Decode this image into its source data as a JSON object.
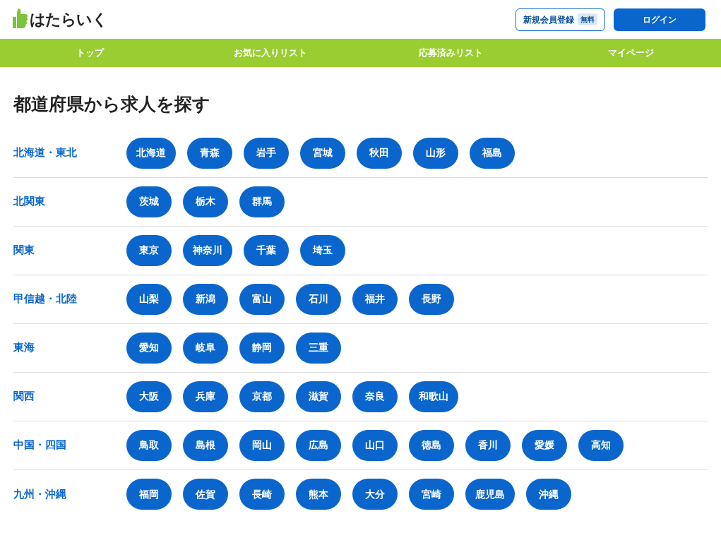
{
  "logo": {
    "text": "はたらいく"
  },
  "header": {
    "register": {
      "label": "新規会員登録",
      "badge": "無料"
    },
    "login": "ログイン"
  },
  "nav": [
    "トップ",
    "お気に入りリスト",
    "応募済みリスト",
    "マイページ"
  ],
  "title": "都道府県から求人を探す",
  "regions": [
    {
      "name": "北海道・東北",
      "prefectures": [
        "北海道",
        "青森",
        "岩手",
        "宮城",
        "秋田",
        "山形",
        "福島"
      ]
    },
    {
      "name": "北関東",
      "prefectures": [
        "茨城",
        "栃木",
        "群馬"
      ]
    },
    {
      "name": "関東",
      "prefectures": [
        "東京",
        "神奈川",
        "千葉",
        "埼玉"
      ]
    },
    {
      "name": "甲信越・北陸",
      "prefectures": [
        "山梨",
        "新潟",
        "富山",
        "石川",
        "福井",
        "長野"
      ]
    },
    {
      "name": "東海",
      "prefectures": [
        "愛知",
        "岐阜",
        "静岡",
        "三重"
      ]
    },
    {
      "name": "関西",
      "prefectures": [
        "大阪",
        "兵庫",
        "京都",
        "滋賀",
        "奈良",
        "和歌山"
      ]
    },
    {
      "name": "中国・四国",
      "prefectures": [
        "鳥取",
        "島根",
        "岡山",
        "広島",
        "山口",
        "徳島",
        "香川",
        "愛媛",
        "高知"
      ]
    },
    {
      "name": "九州・沖縄",
      "prefectures": [
        "福岡",
        "佐賀",
        "長崎",
        "熊本",
        "大分",
        "宮崎",
        "鹿児島",
        "沖縄"
      ]
    }
  ]
}
